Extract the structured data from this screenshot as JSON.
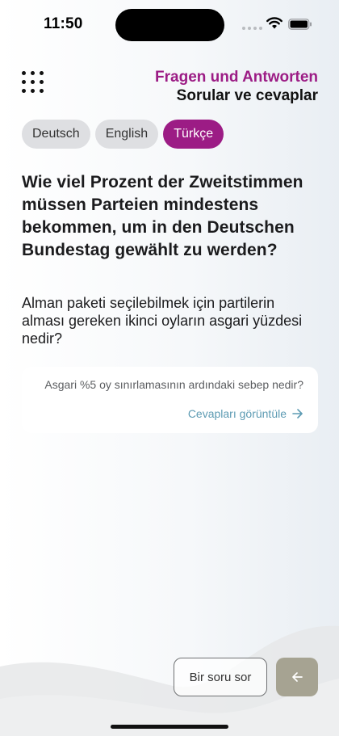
{
  "status_bar": {
    "time": "11:50",
    "icons": [
      "signal-dots-icon",
      "wifi-icon",
      "battery-icon"
    ]
  },
  "header": {
    "menu_icon": "grid-menu-icon",
    "title_primary": "Fragen und Antworten",
    "title_secondary": "Sorular ve cevaplar",
    "accent_color": "#9c1c85"
  },
  "languages": [
    {
      "label": "Deutsch",
      "active": false
    },
    {
      "label": "English",
      "active": false
    },
    {
      "label": "Türkçe",
      "active": true
    }
  ],
  "question": {
    "german": "Wie viel Prozent der Zweitstimmen müssen Parteien mindestens bekommen, um in den Deutschen Bundestag gewählt zu werden?",
    "turkish": "Alman paketi seçilebilmek için partilerin alması gereken ikinci oyların asgari yüzdesi nedir?"
  },
  "related_card": {
    "question": "Asgari %5 oy sınırlamasının ardındaki sebep nedir?",
    "link_label": "Cevapları görüntüle",
    "link_icon": "arrow-right-icon",
    "link_color": "#5d9bb3"
  },
  "footer": {
    "ask_label": "Bir soru sor",
    "back_icon": "arrow-left-icon",
    "back_color": "#a6a392"
  }
}
